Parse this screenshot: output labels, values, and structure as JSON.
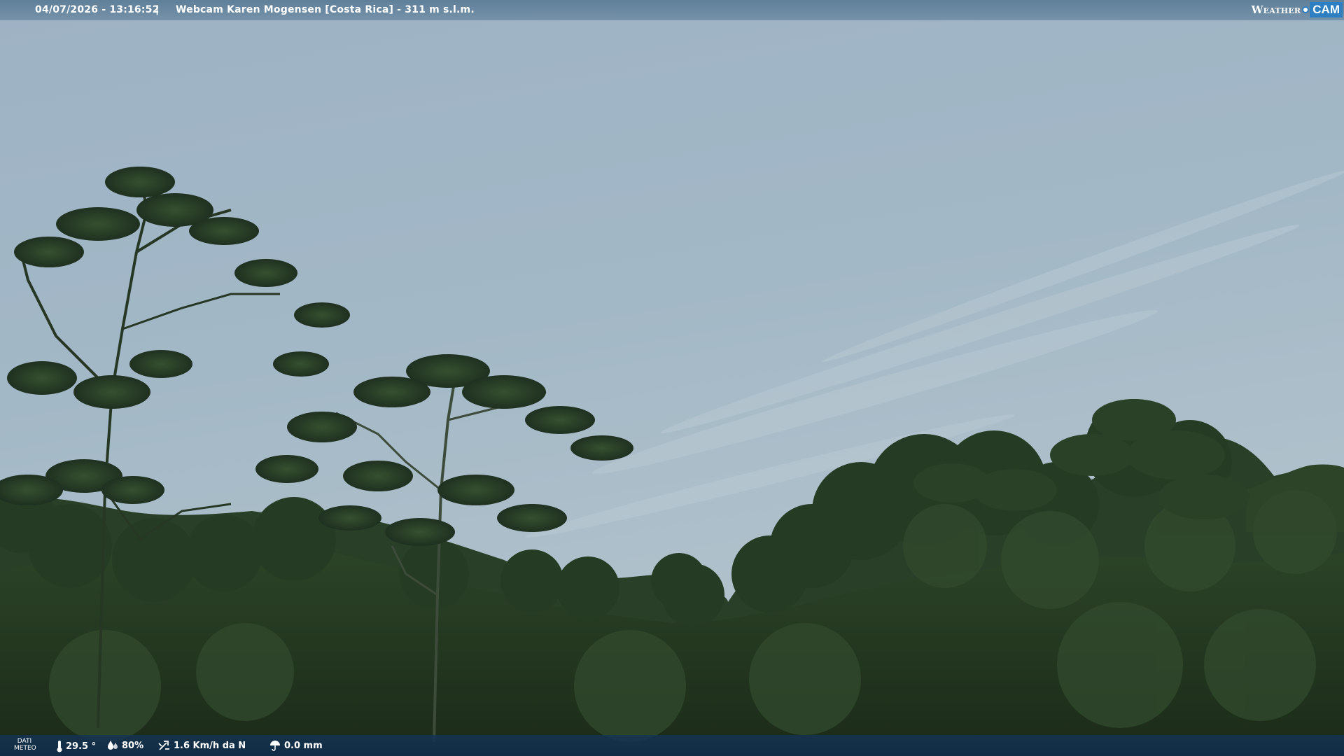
{
  "header": {
    "datetime": "04/07/2026 - 13:16:52",
    "separator": "|",
    "title": "Webcam Karen Mogensen [Costa Rica]  - 311 m s.l.m."
  },
  "logo": {
    "weather": "Weather",
    "cam": "CAM",
    "brand_color": "#2d7fc1"
  },
  "footer": {
    "label_line1": "DATI",
    "label_line2": "METEO",
    "temperature": "29.5 °",
    "humidity": "80%",
    "wind": "1.6 Km/h da N",
    "rain": "0.0 mm",
    "icons": [
      "thermometer-icon",
      "humidity-icon",
      "wind-icon",
      "rain-icon"
    ]
  },
  "colors": {
    "sky": "#9fb3c3",
    "forest": "#24381f",
    "bar_top": "#5c7c96",
    "bar_bottom": "#143454"
  }
}
